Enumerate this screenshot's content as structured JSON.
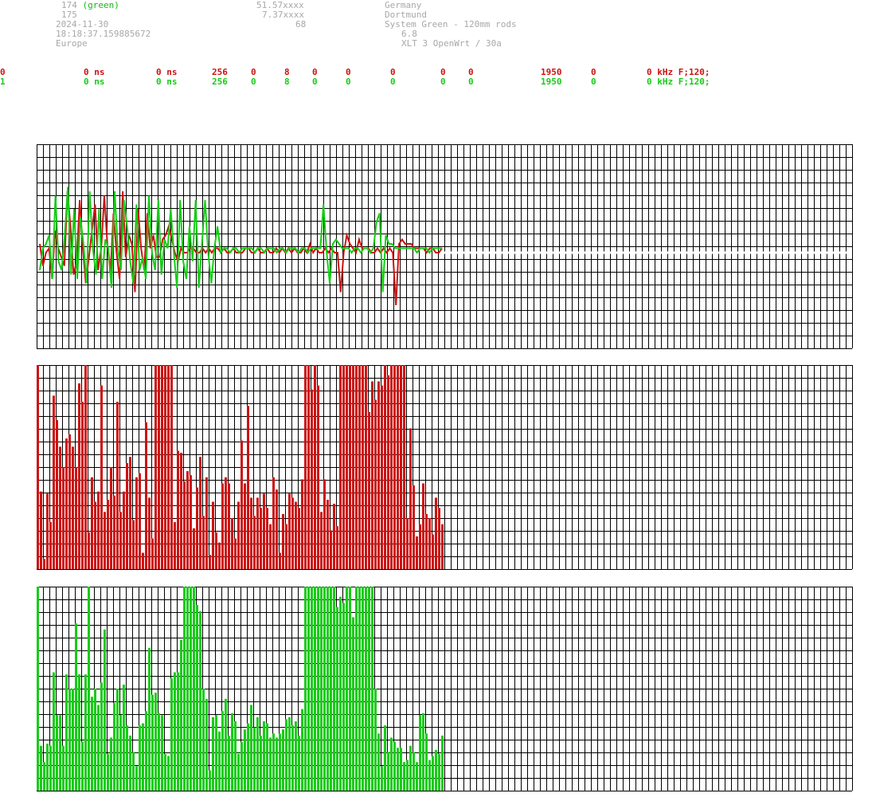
{
  "header": {
    "sensor_id_1": "174",
    "sensor_color_label": "(green)",
    "sensor_id_2": "175",
    "date": "2024-11-30",
    "time": "18:18:37.159885672",
    "region": "Europe",
    "latitude": "51.57xxxx",
    "longitude": "7.37xxxx",
    "altitude": "68",
    "country": "Germany",
    "city": "Dortmund",
    "system": "System Green - 120mm rods",
    "version": "6.8",
    "hardware": "XLT 3 OpenWrt / 30a"
  },
  "channels": [
    {
      "cells": [
        "0",
        "0 ns",
        "0 ns",
        "256",
        "0",
        "8",
        "0",
        "0",
        "0",
        "0",
        "0",
        "1950",
        "0",
        "0 kHz F;120;"
      ],
      "color": "#cc1111"
    },
    {
      "cells": [
        "1",
        "0 ns",
        "0 ns",
        "256",
        "0",
        "8",
        "0",
        "0",
        "0",
        "0",
        "0",
        "1950",
        "0",
        "0 kHz F;120;"
      ],
      "color": "#16cc16"
    }
  ],
  "colors": {
    "red": "#cc1111",
    "green": "#16cc16",
    "grid": "#000000",
    "header": "#a8a8a8"
  },
  "chart_data": [
    {
      "type": "line",
      "ylim": [
        -1,
        1
      ],
      "series": [
        {
          "color": "#cc1111",
          "values": [
            0.1,
            -0.15,
            0.0,
            0.05,
            -0.3,
            0.25,
            0.05,
            -0.05,
            -0.15,
            0.7,
            0.3,
            -0.25,
            -0.1,
            0.6,
            0.05,
            -0.35,
            -0.05,
            0.25,
            0.55,
            -0.2,
            0.05,
            0.65,
            0.1,
            -0.25,
            0.45,
            0.0,
            -0.3,
            0.7,
            -0.05,
            0.2,
            0.1,
            -0.45,
            0.5,
            0.05,
            -0.2,
            0.45,
            0.05,
            0.2,
            -0.05,
            -0.05,
            0.15,
            0.2,
            0.3,
            0.15,
            0.0,
            -0.1,
            0.05,
            0.0,
            0.0,
            0.05,
            0.05,
            0.0,
            0.0,
            0.05,
            0.0,
            0.05,
            0.0,
            0.05,
            0.05,
            0.0,
            0.05,
            0.0,
            0.0,
            0.05,
            0.0,
            0.0,
            0.0,
            0.05,
            0.05,
            0.0,
            0.0,
            0.05,
            0.0,
            0.0,
            0.05,
            0.0,
            0.0,
            0.05,
            0.0,
            0.05,
            0.0,
            0.05,
            0.0,
            0.05,
            0.0,
            0.0,
            0.05,
            0.0,
            0.1,
            0.0,
            0.05,
            0.0,
            0.0,
            0.05,
            0.0,
            0.05,
            0.0,
            0.0,
            -0.45,
            0.0,
            0.2,
            0.1,
            0.05,
            0.0,
            0.15,
            0.05,
            0.05,
            0.05,
            0.0,
            0.0,
            0.05,
            0.0,
            0.05,
            0.0,
            0.05,
            0.0,
            -0.6,
            0.1,
            0.15,
            0.1,
            0.1,
            0.1,
            0.05,
            0.05,
            0.05,
            0.05,
            0.0,
            0.05,
            0.05,
            0.0,
            0.0,
            0.05
          ],
          "x_start": 0,
          "x_end": 127
        },
        {
          "color": "#16cc16",
          "values": [
            -0.2,
            0.05,
            0.1,
            0.2,
            -0.3,
            0.65,
            -0.1,
            -0.2,
            0.2,
            0.75,
            -0.25,
            0.5,
            -0.3,
            0.4,
            0.1,
            -0.35,
            0.7,
            0.05,
            -0.25,
            0.5,
            -0.3,
            0.15,
            0.05,
            -0.4,
            0.7,
            0.05,
            -0.2,
            0.6,
            0.3,
            -0.1,
            -0.35,
            0.55,
            -0.2,
            -0.05,
            -0.3,
            0.65,
            0.0,
            -0.2,
            0.6,
            -0.25,
            0.15,
            0.05,
            0.5,
            0.0,
            -0.4,
            0.6,
            -0.1,
            -0.3,
            0.3,
            -0.1,
            0.6,
            -0.4,
            0.1,
            0.6,
            0.0,
            -0.35,
            0.05,
            0.3,
            0.0,
            0.05,
            0.05,
            0.0,
            0.05,
            0.05,
            0.0,
            0.05,
            0.05,
            0.05,
            0.05,
            0.0,
            0.05,
            0.05,
            0.0,
            0.05,
            0.05,
            0.05,
            0.0,
            0.05,
            0.05,
            0.0,
            0.05,
            0.05,
            0.05,
            0.0,
            0.05,
            0.05,
            0.0,
            0.05,
            0.05,
            0.05,
            0.05,
            0.55,
            0.0,
            -0.35,
            0.1,
            0.15,
            0.1,
            0.05,
            0.05,
            0.05,
            0.0,
            0.05,
            0.05,
            0.0,
            0.05,
            0.05,
            0.0,
            0.05,
            0.35,
            0.45,
            -0.45,
            0.2,
            0.1,
            0.1,
            0.05,
            0.05,
            0.05,
            0.05,
            0.05,
            0.05,
            0.05,
            0.0,
            0.05,
            0.05,
            0.05,
            0.0,
            0.05,
            0.05,
            0.05,
            0.05
          ],
          "x_start": 0,
          "x_end": 127
        }
      ],
      "grid": true
    },
    {
      "type": "bar",
      "color": "#cc1111",
      "ylim": [
        0,
        1
      ],
      "values": [
        1.0,
        0.38,
        0.05,
        0.37,
        0.23,
        0.85,
        0.73,
        0.6,
        0.5,
        0.64,
        0.66,
        0.6,
        0.5,
        0.91,
        0.82,
        1.0,
        0.18,
        0.45,
        0.33,
        0.38,
        0.9,
        0.28,
        0.34,
        0.5,
        0.36,
        0.82,
        0.28,
        0.38,
        0.52,
        0.55,
        0.24,
        0.45,
        0.47,
        0.08,
        0.72,
        0.35,
        0.15,
        1.0,
        1.0,
        1.0,
        1.0,
        1.0,
        1.0,
        0.23,
        0.58,
        0.57,
        0.43,
        0.48,
        0.46,
        0.2,
        0.4,
        0.55,
        0.26,
        0.45,
        0.07,
        0.33,
        0.18,
        0.13,
        0.42,
        0.45,
        0.42,
        0.25,
        0.15,
        0.33,
        0.63,
        0.42,
        0.8,
        0.35,
        0.26,
        0.35,
        0.3,
        0.37,
        0.3,
        0.22,
        0.45,
        0.39,
        0.08,
        0.27,
        0.22,
        0.37,
        0.35,
        0.33,
        0.3,
        0.44,
        1.0,
        1.0,
        0.88,
        1.0,
        0.9,
        0.28,
        0.44,
        0.34,
        0.19,
        0.32,
        0.21,
        1.0,
        1.0,
        1.0,
        1.0,
        1.0,
        1.0,
        1.0,
        1.0,
        1.0,
        0.77,
        0.92,
        0.83,
        0.92,
        0.9,
        1.0,
        0.95,
        1.0,
        1.0,
        1.0,
        1.0,
        1.0,
        0.25,
        0.69,
        0.41,
        0.16,
        0.22,
        0.42,
        0.27,
        0.25,
        0.17,
        0.35,
        0.3,
        0.22
      ],
      "grid": true
    },
    {
      "type": "bar",
      "color": "#16cc16",
      "ylim": [
        0,
        1
      ],
      "values": [
        1.0,
        0.22,
        0.14,
        0.23,
        0.22,
        0.58,
        0.37,
        0.37,
        0.22,
        0.57,
        0.5,
        0.5,
        0.82,
        0.57,
        0.24,
        0.57,
        1.0,
        0.46,
        0.5,
        0.42,
        0.53,
        0.79,
        0.18,
        0.26,
        0.43,
        0.5,
        0.37,
        0.52,
        0.32,
        0.27,
        0.19,
        0.12,
        0.32,
        0.33,
        0.39,
        0.7,
        0.47,
        0.48,
        0.38,
        0.37,
        0.18,
        0.17,
        0.55,
        0.58,
        0.58,
        0.74,
        1.0,
        1.0,
        1.0,
        1.0,
        0.91,
        0.88,
        0.5,
        0.45,
        0.1,
        0.36,
        0.37,
        0.29,
        0.39,
        0.45,
        0.27,
        0.38,
        0.34,
        0.18,
        0.24,
        0.3,
        0.33,
        0.42,
        0.31,
        0.36,
        0.27,
        0.34,
        0.33,
        0.26,
        0.28,
        0.26,
        0.28,
        0.3,
        0.35,
        0.36,
        0.32,
        0.34,
        0.27,
        0.4,
        1.0,
        1.0,
        1.0,
        1.0,
        1.0,
        1.0,
        1.0,
        1.0,
        1.0,
        1.0,
        0.9,
        0.95,
        0.92,
        1.0,
        1.0,
        0.85,
        1.0,
        1.0,
        1.0,
        1.0,
        1.0,
        1.0,
        0.5,
        0.28,
        0.12,
        0.32,
        0.19,
        0.26,
        0.24,
        0.21,
        0.21,
        0.14,
        0.15,
        0.22,
        0.19,
        0.14,
        0.37,
        0.38,
        0.28,
        0.15,
        0.17,
        0.2,
        0.18,
        0.27
      ],
      "grid": true
    }
  ]
}
